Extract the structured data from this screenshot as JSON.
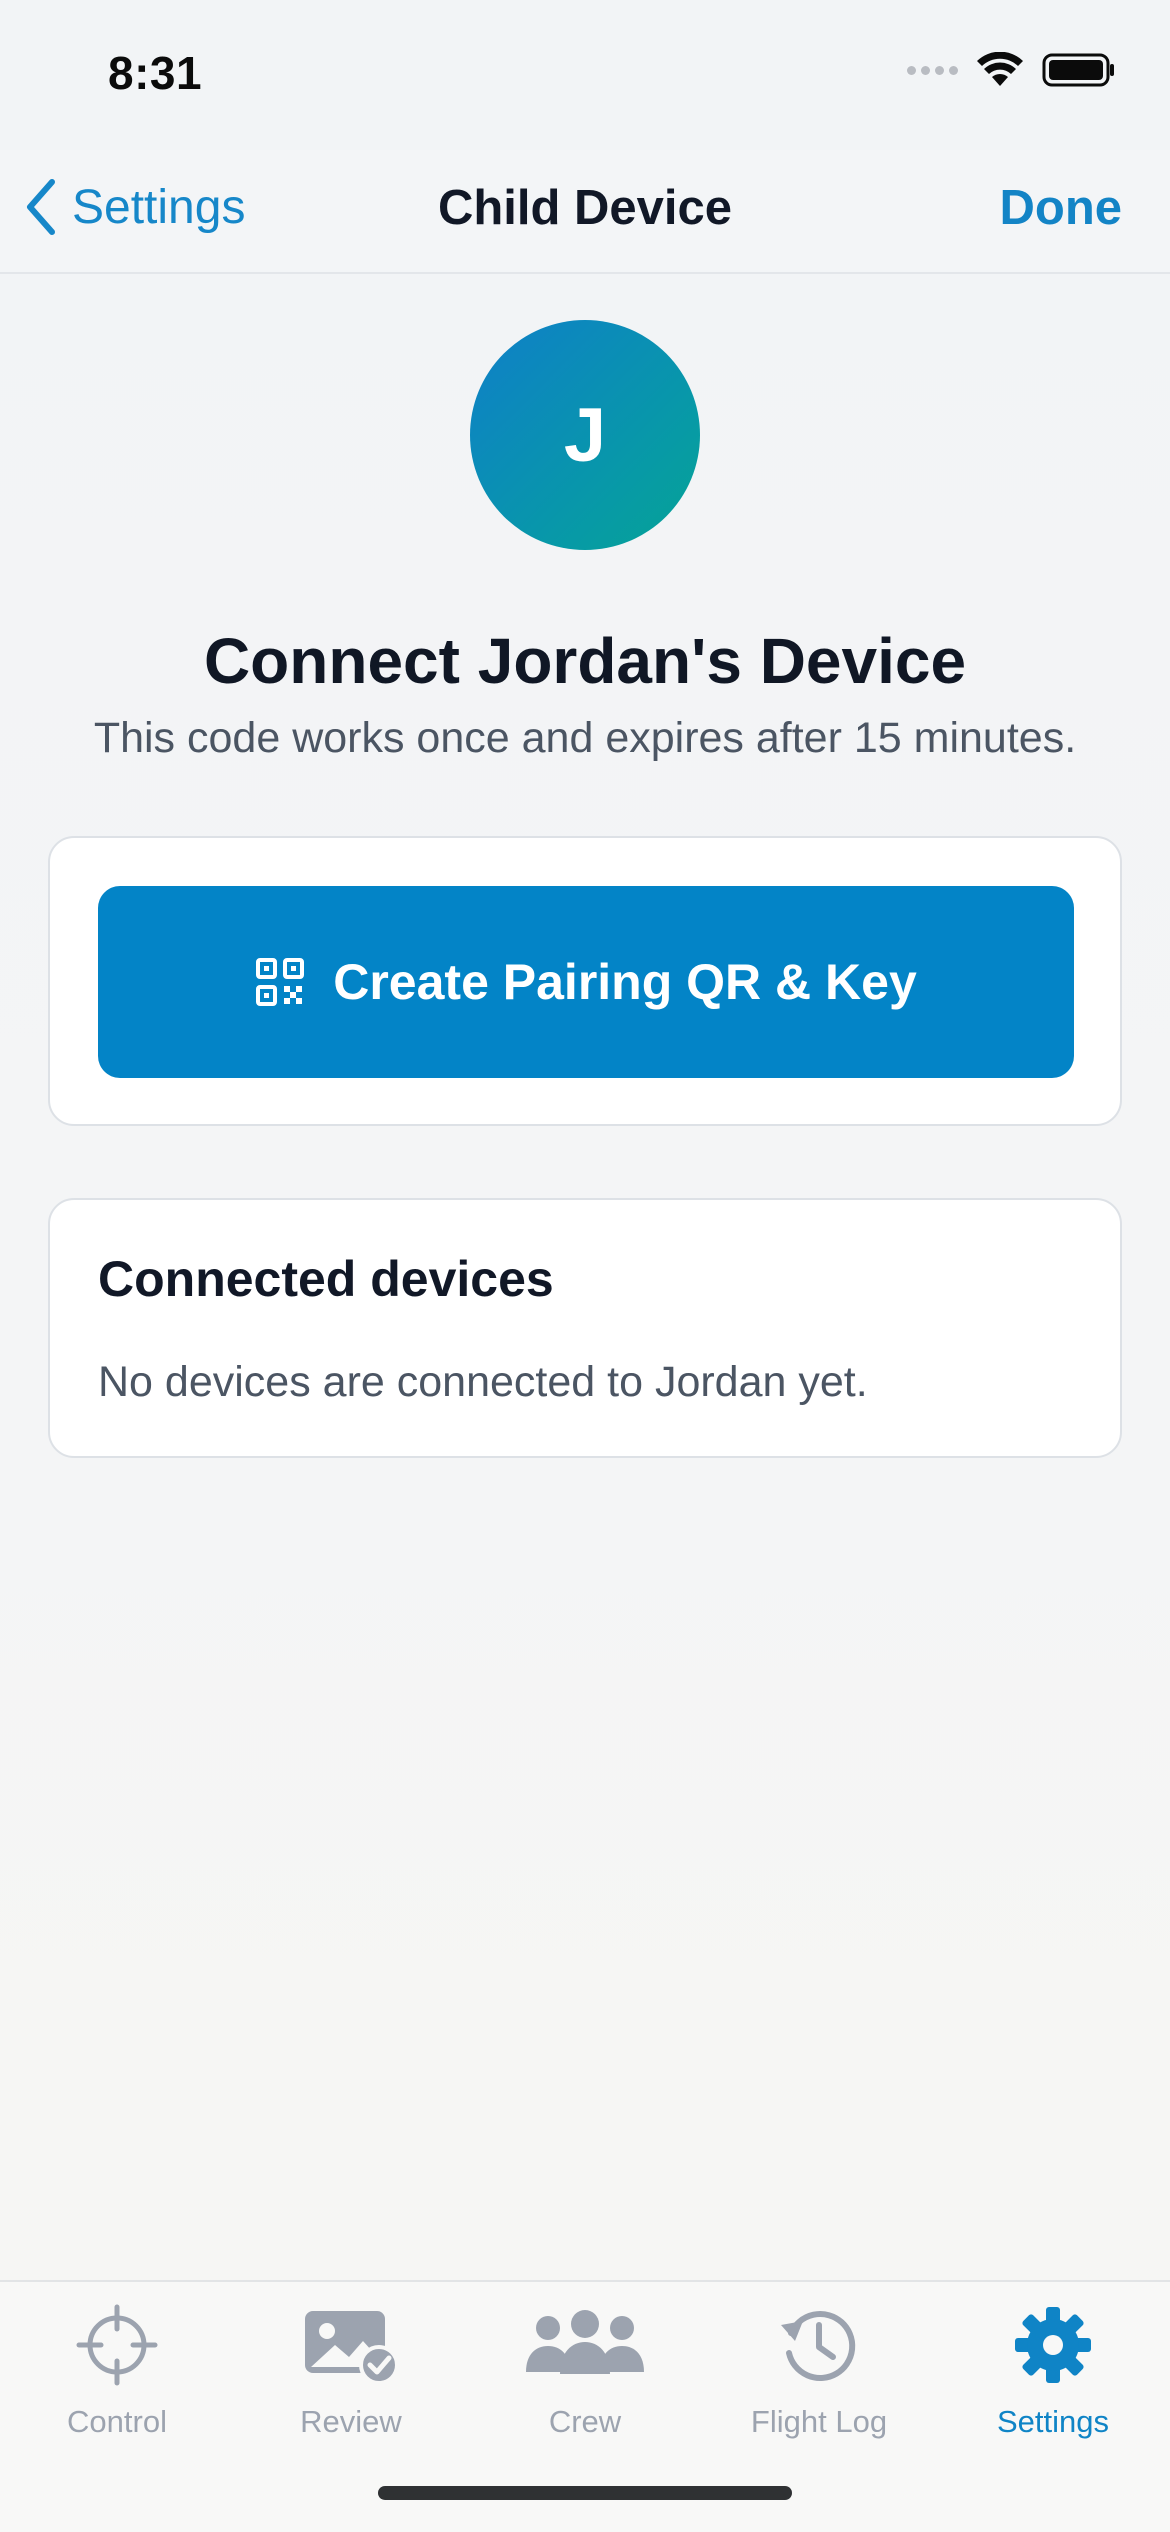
{
  "status_bar": {
    "time": "8:31"
  },
  "nav": {
    "back_label": "Settings",
    "title": "Child Device",
    "done_label": "Done"
  },
  "header": {
    "avatar_initial": "J",
    "heading": "Connect Jordan's Device",
    "subtitle": "This code works once and expires after 15 minutes."
  },
  "pairing": {
    "button_label": "Create Pairing QR & Key",
    "button_icon": "qr-code-icon"
  },
  "devices": {
    "title": "Connected devices",
    "empty_text": "No devices are connected to Jordan yet."
  },
  "tabs": [
    {
      "label": "Control",
      "icon": "crosshair-icon",
      "active": false
    },
    {
      "label": "Review",
      "icon": "photo-check-icon",
      "active": false
    },
    {
      "label": "Crew",
      "icon": "people-icon",
      "active": false
    },
    {
      "label": "Flight Log",
      "icon": "history-clock-icon",
      "active": false
    },
    {
      "label": "Settings",
      "icon": "gear-icon",
      "active": true
    }
  ],
  "colors": {
    "accent": "#0384C7",
    "inactive_tab": "#9CA3AF",
    "avatar_start": "#0F7FC9",
    "avatar_end": "#06A395"
  }
}
